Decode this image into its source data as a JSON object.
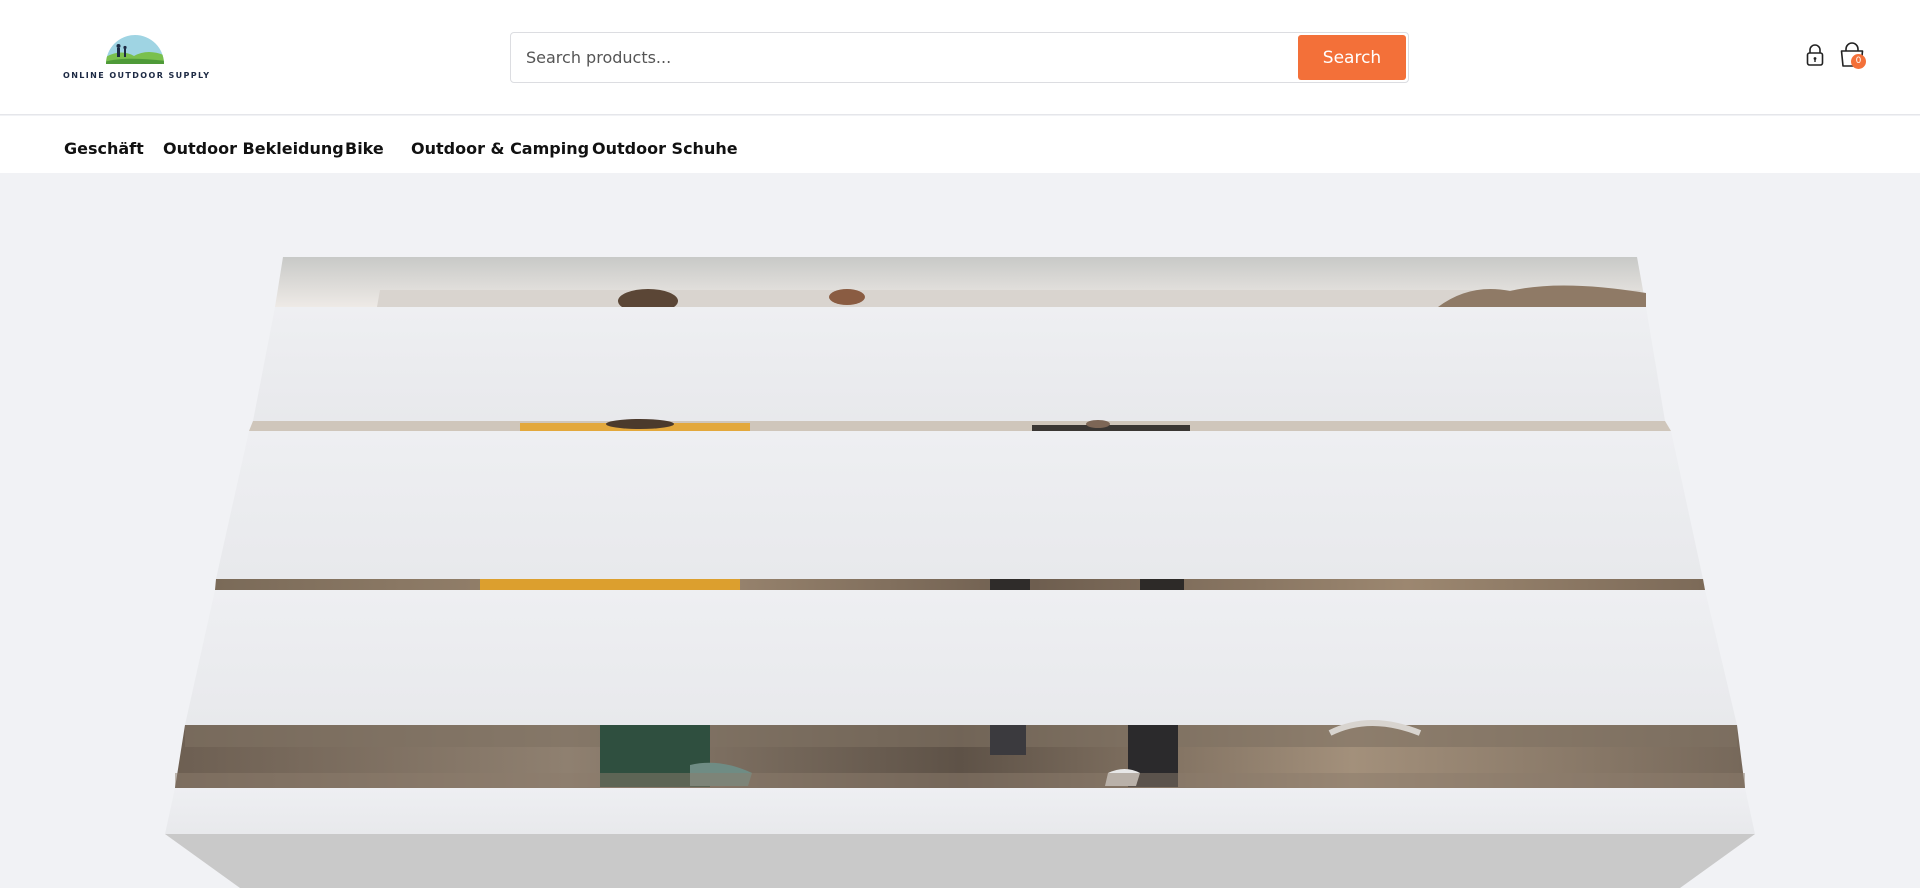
{
  "brand": {
    "logo_text": "ONLINE OUTDOOR SUPPLY"
  },
  "search": {
    "placeholder": "Search products...",
    "button_label": "Search"
  },
  "cart": {
    "count": "0"
  },
  "nav": {
    "items": [
      "Geschäft",
      "Outdoor Bekleidung",
      "Bike",
      "Outdoor & Camping",
      "Outdoor Schuhe"
    ]
  },
  "colors": {
    "accent": "#f37039",
    "background": "#f1f2f5",
    "brand_text": "#1d2a44"
  },
  "icons": {
    "account": "lock-icon",
    "cart": "shopping-bag-icon"
  }
}
